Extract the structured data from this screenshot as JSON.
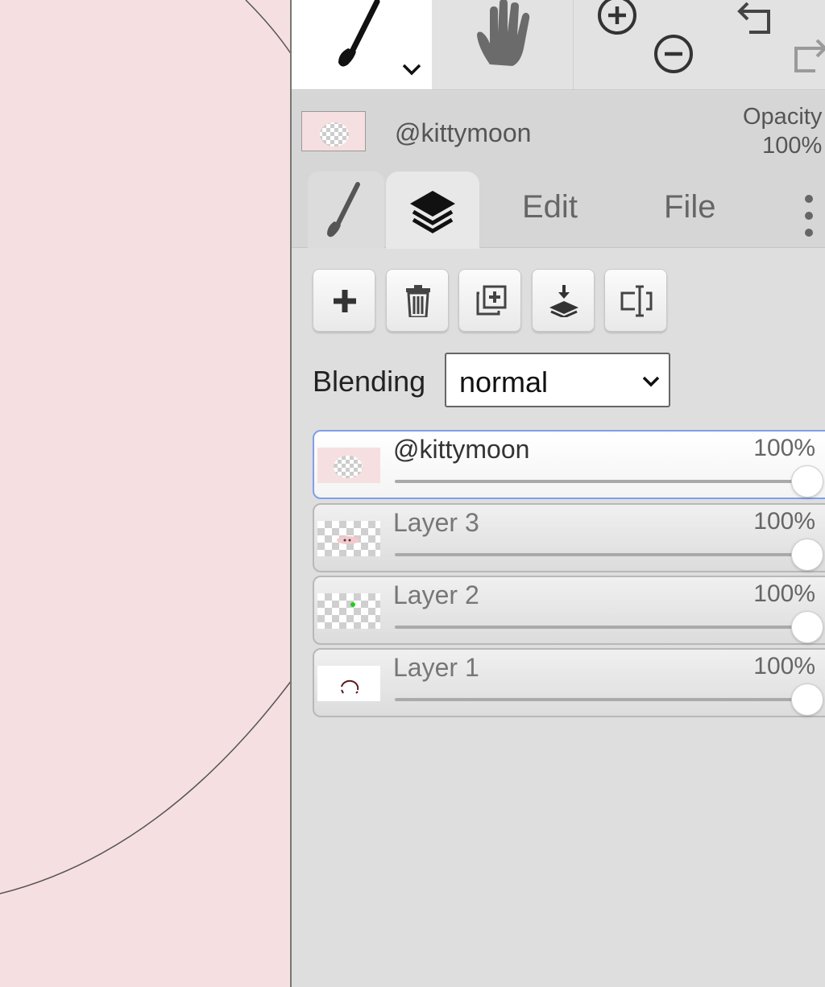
{
  "toolbar": {
    "tools": [
      {
        "name": "brush",
        "icon": "brush-icon",
        "selected": true
      },
      {
        "name": "hand",
        "icon": "hand-icon"
      },
      {
        "name": "zoom",
        "icons": [
          "zoom-in-icon",
          "zoom-out-icon"
        ]
      },
      {
        "name": "history",
        "icons": [
          "undo-icon",
          "redo-icon"
        ]
      }
    ]
  },
  "current_layer": {
    "name": "@kittymoon",
    "opacity_label": "Opacity",
    "opacity_value": "100%"
  },
  "tabs": [
    {
      "id": "brush",
      "icon": "brush-icon"
    },
    {
      "id": "layers",
      "icon": "layers-icon",
      "active": true
    },
    {
      "id": "edit",
      "label": "Edit"
    },
    {
      "id": "file",
      "label": "File"
    },
    {
      "id": "more",
      "icon": "more-vertical-icon"
    }
  ],
  "layer_actions": [
    {
      "id": "add",
      "icon": "plus-icon"
    },
    {
      "id": "delete",
      "icon": "trash-icon"
    },
    {
      "id": "duplicate",
      "icon": "duplicate-icon"
    },
    {
      "id": "merge",
      "icon": "merge-down-icon"
    },
    {
      "id": "rename",
      "icon": "rename-icon"
    }
  ],
  "blending": {
    "label": "Blending",
    "value": "normal"
  },
  "layers": [
    {
      "name": "@kittymoon",
      "opacity": "100%",
      "opacity_fraction": 1.0,
      "selected": true
    },
    {
      "name": "Layer 3",
      "opacity": "100%",
      "opacity_fraction": 1.0
    },
    {
      "name": "Layer 2",
      "opacity": "100%",
      "opacity_fraction": 1.0
    },
    {
      "name": "Layer 1",
      "opacity": "100%",
      "opacity_fraction": 1.0
    }
  ],
  "colors": {
    "canvas": "#f6dfe1",
    "panel": "#dddddd",
    "selection_border": "#7f9fe8",
    "layer2_dot": "#22cc22",
    "layer1_stroke": "#5a1a1a"
  }
}
